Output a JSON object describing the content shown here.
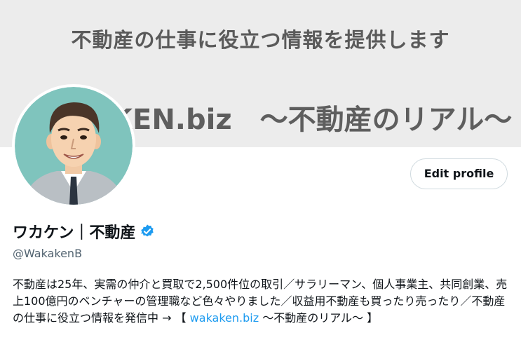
{
  "banner": {
    "tagline": "不動産の仕事に役立つ情報を提供します",
    "title": "KEN.biz　〜不動産のリアル〜",
    "background": "#ececec"
  },
  "profile": {
    "edit_label": "Edit profile",
    "display_name": "ワカケン｜不動産",
    "handle": "@WakakenB",
    "verified_icon": "verified-badge-icon",
    "bio_text": "不動産は25年、実需の仲介と買取で2,500件位の取引／サラリーマン、個人事業主、共同創業、売上100億円のベンチャーの管理職など色々やりました／収益用不動産も買ったり売ったり／不動産の仕事に役立つ情報を発信中 → 【 ",
    "bio_link": "wakaken.biz",
    "bio_suffix": " 〜不動産のリアル〜 】"
  },
  "colors": {
    "link": "#1d9bf0",
    "verified": "#1d9bf0",
    "text": "#0f1419",
    "secondary_text": "#536471",
    "avatar_bg": "#7fc4bd"
  }
}
